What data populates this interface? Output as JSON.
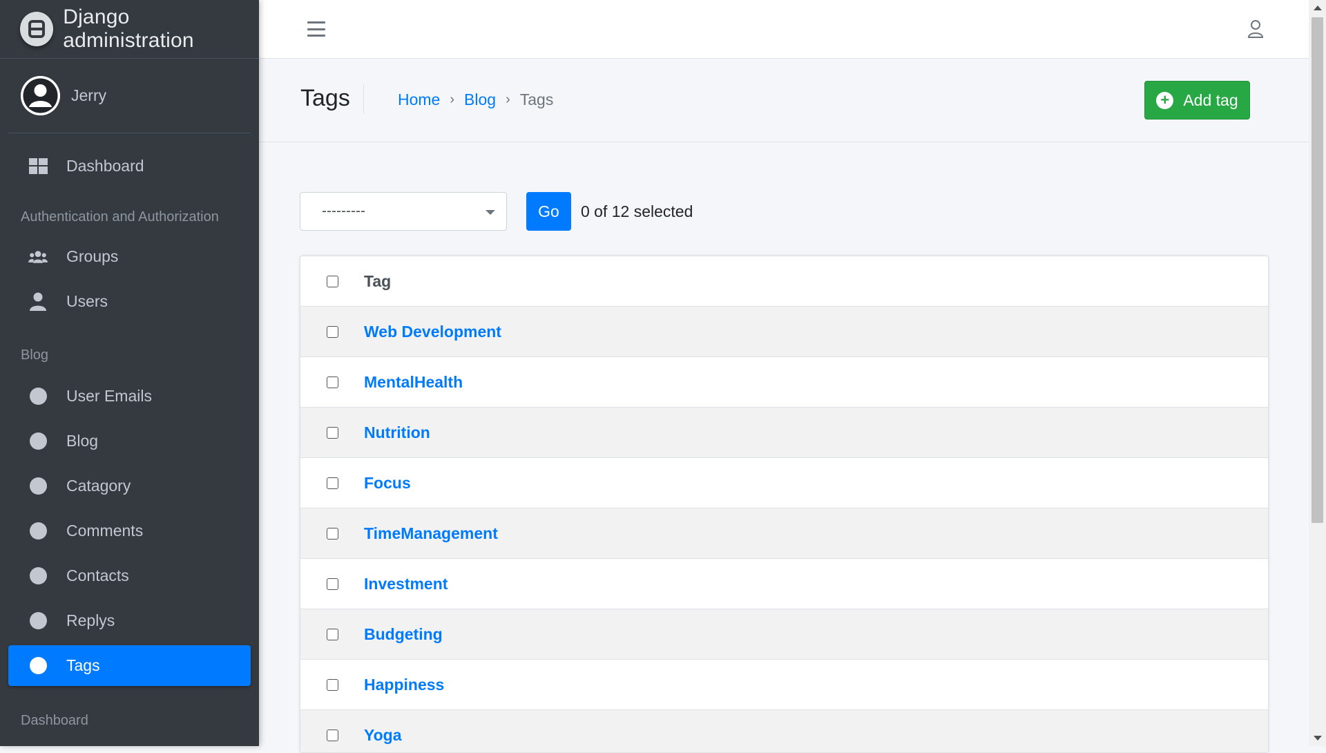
{
  "brand": {
    "title": "Django administration"
  },
  "user": {
    "name": "Jerry"
  },
  "sidebar": {
    "dashboard": {
      "label": "Dashboard",
      "icon": "dashboard-icon"
    },
    "auth_header": "Authentication and Authorization",
    "auth_items": [
      {
        "label": "Groups",
        "icon": "users-group-icon"
      },
      {
        "label": "Users",
        "icon": "user-icon"
      }
    ],
    "blog_header": "Blog",
    "blog_items": [
      {
        "label": "User Emails",
        "icon": "circle-icon"
      },
      {
        "label": "Blog",
        "icon": "circle-icon"
      },
      {
        "label": "Catagory",
        "icon": "circle-icon"
      },
      {
        "label": "Comments",
        "icon": "circle-icon"
      },
      {
        "label": "Contacts",
        "icon": "circle-icon"
      },
      {
        "label": "Replys",
        "icon": "circle-icon"
      },
      {
        "label": "Tags",
        "icon": "circle-icon",
        "active": true
      }
    ],
    "footer_header": "Dashboard"
  },
  "header": {
    "page_title": "Tags",
    "breadcrumb": {
      "home": "Home",
      "blog": "Blog",
      "current": "Tags"
    },
    "add_label": "Add tag"
  },
  "actions": {
    "select_value": "---------",
    "go_label": "Go",
    "counter": "0 of 12 selected"
  },
  "table": {
    "column": "Tag",
    "rows": [
      "Web Development",
      "MentalHealth",
      "Nutrition",
      "Focus",
      "TimeManagement",
      "Investment",
      "Budgeting",
      "Happiness",
      "Yoga"
    ]
  },
  "colors": {
    "primary": "#007bff",
    "success": "#28a745",
    "sidebar": "#343a40"
  }
}
